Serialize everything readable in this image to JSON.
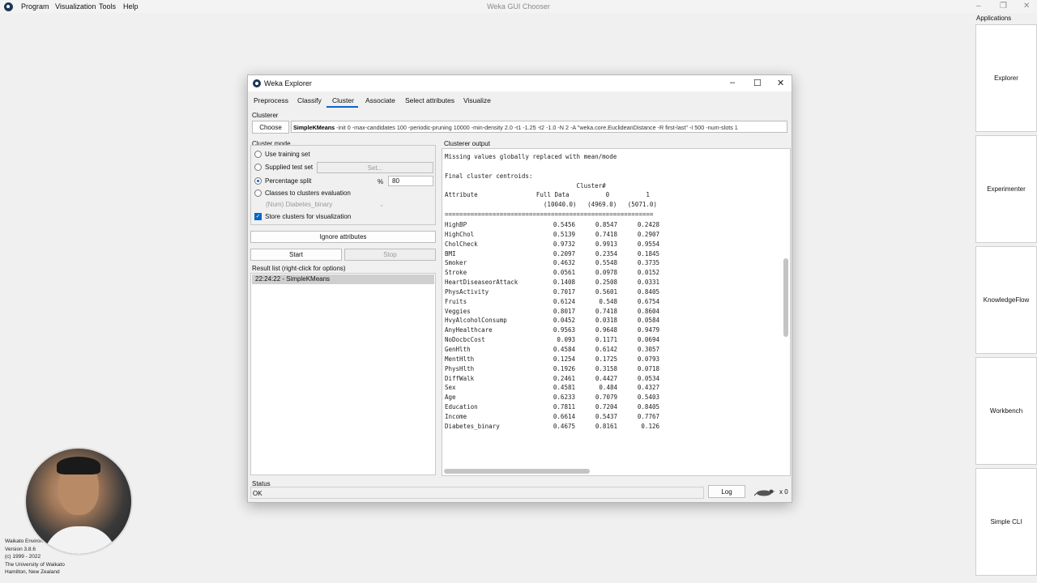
{
  "chooser": {
    "title": "Weka GUI Chooser",
    "menu": [
      "Program",
      "Visualization",
      "Tools",
      "Help"
    ],
    "applications_label": "Applications",
    "applications": [
      "Explorer",
      "Experimenter",
      "KnowledgeFlow",
      "Workbench",
      "Simple CLI"
    ],
    "footer": [
      "Waikato Environ",
      "Version 3.8.6",
      "(c) 1999 - 2022",
      "The University of Waikato",
      "Hamilton, New Zealand"
    ]
  },
  "explorer": {
    "title": "Weka Explorer",
    "tabs": [
      "Preprocess",
      "Classify",
      "Cluster",
      "Associate",
      "Select attributes",
      "Visualize"
    ],
    "active_tab": "Cluster",
    "clusterer": {
      "label": "Clusterer",
      "choose_label": "Choose",
      "name": "SimpleKMeans",
      "options": " -init 0 -max-candidates 100 -periodic-pruning 10000 -min-density 2.0 -t1 -1.25 -t2 -1.0 -N 2 -A \"weka.core.EuclideanDistance -R first-last\" -I 500 -num-slots 1"
    },
    "cluster_mode": {
      "label": "Cluster mode",
      "use_training_set": "Use training set",
      "supplied_test_set": "Supplied test set",
      "set_button": "Set...",
      "percentage_split": "Percentage split",
      "percent_symbol": "%",
      "percent_value": "80",
      "classes_to_clusters": "Classes to clusters evaluation",
      "class_attribute": "(Num) Diabetes_binary",
      "store_clusters": "Store clusters for visualization",
      "selected": "Percentage split"
    },
    "ignore_attributes_label": "Ignore attributes",
    "start_label": "Start",
    "stop_label": "Stop",
    "result_list": {
      "label": "Result list (right-click for options)",
      "items": [
        "22:24:22 - SimpleKMeans"
      ]
    },
    "output": {
      "label": "Clusterer output",
      "header_text": "Missing values globally replaced with mean/mode\n\nFinal cluster centroids:\n                                    Cluster#\nAttribute                Full Data          0          1\n                           (10040.0)   (4969.0)   (5071.0)\n=========================================================",
      "rows": [
        [
          "HighBP",
          "0.5456",
          "0.8547",
          "0.2428"
        ],
        [
          "HighChol",
          "0.5139",
          "0.7418",
          "0.2907"
        ],
        [
          "CholCheck",
          "0.9732",
          "0.9913",
          "0.9554"
        ],
        [
          "BMI",
          "0.2097",
          "0.2354",
          "0.1845"
        ],
        [
          "Smoker",
          "0.4632",
          "0.5548",
          "0.3735"
        ],
        [
          "Stroke",
          "0.0561",
          "0.0978",
          "0.0152"
        ],
        [
          "HeartDiseaseorAttack",
          "0.1408",
          "0.2508",
          "0.0331"
        ],
        [
          "PhysActivity",
          "0.7017",
          "0.5601",
          "0.8405"
        ],
        [
          "Fruits",
          "0.6124",
          "0.548",
          "0.6754"
        ],
        [
          "Veggies",
          "0.8017",
          "0.7418",
          "0.8604"
        ],
        [
          "HvyAlcoholConsump",
          "0.0452",
          "0.0318",
          "0.0584"
        ],
        [
          "AnyHealthcare",
          "0.9563",
          "0.9648",
          "0.9479"
        ],
        [
          "NoDocbcCost",
          "0.093",
          "0.1171",
          "0.0694"
        ],
        [
          "GenHlth",
          "0.4584",
          "0.6142",
          "0.3057"
        ],
        [
          "MentHlth",
          "0.1254",
          "0.1725",
          "0.0793"
        ],
        [
          "PhysHlth",
          "0.1926",
          "0.3158",
          "0.0718"
        ],
        [
          "DiffWalk",
          "0.2461",
          "0.4427",
          "0.0534"
        ],
        [
          "Sex",
          "0.4581",
          "0.484",
          "0.4327"
        ],
        [
          "Age",
          "0.6233",
          "0.7079",
          "0.5403"
        ],
        [
          "Education",
          "0.7811",
          "0.7204",
          "0.8405"
        ],
        [
          "Income",
          "0.6614",
          "0.5437",
          "0.7767"
        ],
        [
          "Diabetes_binary",
          "0.4675",
          "0.8161",
          "0.126"
        ]
      ]
    },
    "status": {
      "label": "Status",
      "text": "OK",
      "log_label": "Log",
      "count": "x 0"
    }
  }
}
